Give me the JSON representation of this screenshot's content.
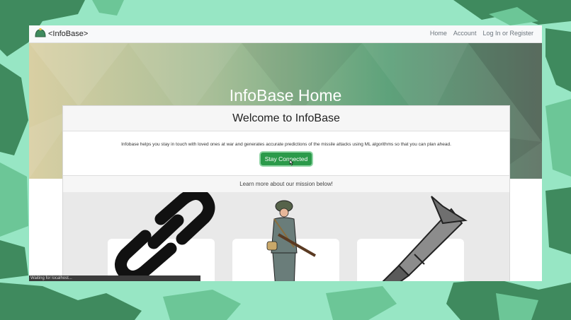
{
  "navbar": {
    "brand": "<InfoBase>",
    "links": [
      "Home",
      "Account",
      "Log In or Register"
    ]
  },
  "hero": {
    "title": "InfoBase Home"
  },
  "card": {
    "title": "Welcome to InfoBase",
    "description": "Infobase helps you stay in touch with loved ones at war and generates accurate predictions of the missile attacks using ML algorithms so that you can plan ahead.",
    "button_label": "Stay Connected",
    "learn_more": "Learn more about our mission below!"
  },
  "mission": {
    "icons": [
      "chain-link-icon",
      "soldier-icon",
      "missile-icon"
    ]
  },
  "status_bar": "Waiting for localhost...",
  "colors": {
    "accent": "#2b9a4a",
    "background": "#97e6c4",
    "camo": "#3f8a5e"
  }
}
